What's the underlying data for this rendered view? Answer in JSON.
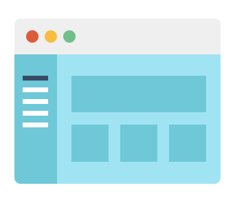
{
  "colors": {
    "titlebar": "#efefef",
    "window_body": "#a0e4f4",
    "sidebar": "#6ec8d8",
    "block": "#6ec8d8",
    "menu_active": "#3a4a63",
    "menu_line": "#ffffff",
    "dot_close": "#dc5b39",
    "dot_minimize": "#f6bd41",
    "dot_maximize": "#6fbf8a"
  },
  "icons": {
    "illustration": "browser-window-layout-icon",
    "menu": "hamburger-menu-icon"
  },
  "sidebar": {
    "menu_lines": [
      {
        "state": "active"
      },
      {
        "state": "normal"
      },
      {
        "state": "normal"
      },
      {
        "state": "normal"
      },
      {
        "state": "normal"
      }
    ]
  }
}
